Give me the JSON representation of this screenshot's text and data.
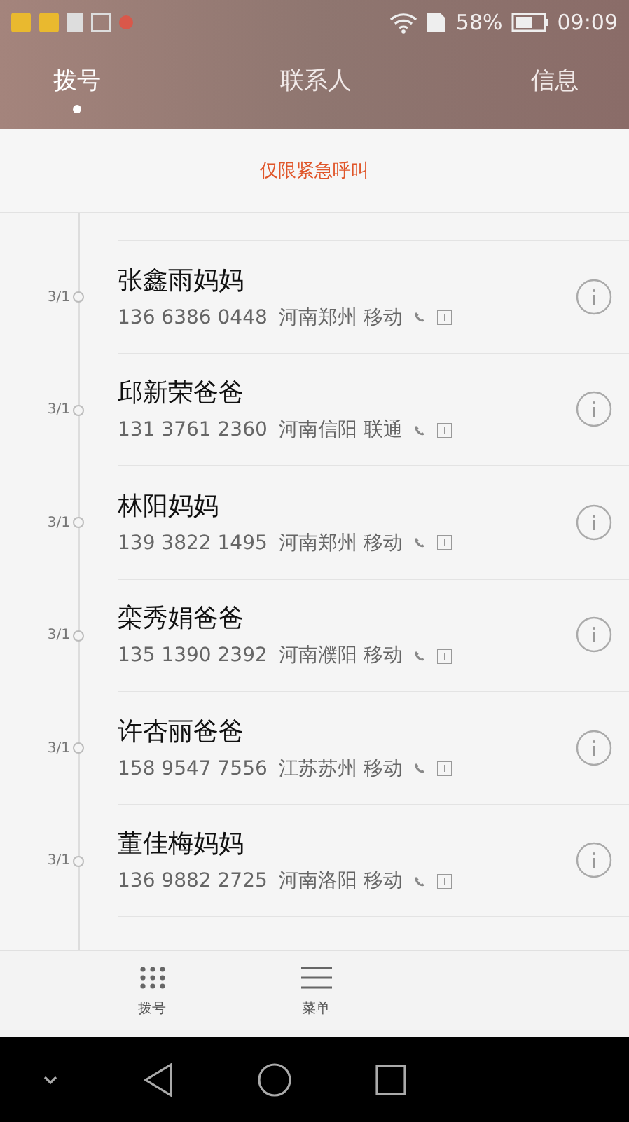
{
  "status_bar": {
    "battery": "58%",
    "time": "09:09"
  },
  "tabs": [
    {
      "label": "拨号",
      "selected": true
    },
    {
      "label": "联系人",
      "selected": false
    },
    {
      "label": "信息",
      "selected": false
    }
  ],
  "notice": "仅限紧急呼叫",
  "calls": [
    {
      "date": "3/1",
      "name": "张鑫雨妈妈",
      "number": "136 6386 0448",
      "location": "河南郑州 移动"
    },
    {
      "date": "3/1",
      "name": "邱新荣爸爸",
      "number": "131 3761 2360",
      "location": "河南信阳 联通"
    },
    {
      "date": "3/1",
      "name": "林阳妈妈",
      "number": "139 3822 1495",
      "location": "河南郑州 移动"
    },
    {
      "date": "3/1",
      "name": "栾秀娟爸爸",
      "number": "135 1390 2392",
      "location": "河南濮阳 移动"
    },
    {
      "date": "3/1",
      "name": "许杏丽爸爸",
      "number": "158 9547 7556",
      "location": "江苏苏州 移动"
    },
    {
      "date": "3/1",
      "name": "董佳梅妈妈",
      "number": "136 9882 2725",
      "location": "河南洛阳 移动"
    }
  ],
  "bottom_bar": [
    {
      "label": "拨号",
      "kind": "dialpad"
    },
    {
      "label": "菜单",
      "kind": "menu"
    }
  ]
}
